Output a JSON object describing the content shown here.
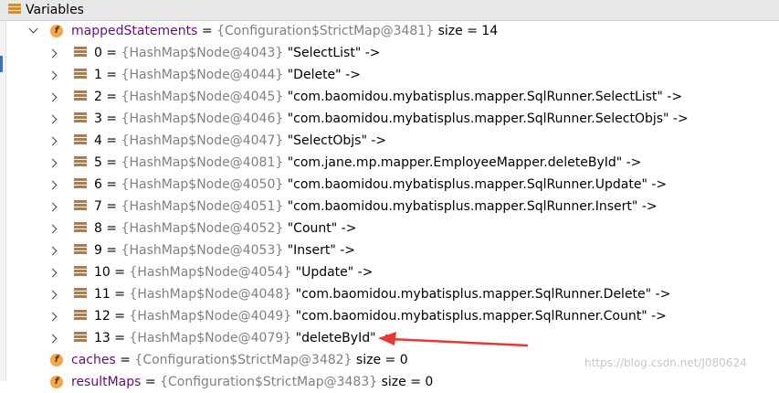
{
  "panel": {
    "title": "Variables"
  },
  "mapped": {
    "name": "mappedStatements",
    "ref": "{Configuration$StrictMap@3481}",
    "size": "size = 14",
    "entries": [
      {
        "key": "0",
        "ref": "{HashMap$Node@4043}",
        "value": "\"SelectList\" ->"
      },
      {
        "key": "1",
        "ref": "{HashMap$Node@4044}",
        "value": "\"Delete\" ->"
      },
      {
        "key": "2",
        "ref": "{HashMap$Node@4045}",
        "value": "\"com.baomidou.mybatisplus.mapper.SqlRunner.SelectList\" ->"
      },
      {
        "key": "3",
        "ref": "{HashMap$Node@4046}",
        "value": "\"com.baomidou.mybatisplus.mapper.SqlRunner.SelectObjs\" ->"
      },
      {
        "key": "4",
        "ref": "{HashMap$Node@4047}",
        "value": "\"SelectObjs\" ->"
      },
      {
        "key": "5",
        "ref": "{HashMap$Node@4081}",
        "value": "\"com.jane.mp.mapper.EmployeeMapper.deleteById\" ->"
      },
      {
        "key": "6",
        "ref": "{HashMap$Node@4050}",
        "value": "\"com.baomidou.mybatisplus.mapper.SqlRunner.Update\" ->"
      },
      {
        "key": "7",
        "ref": "{HashMap$Node@4051}",
        "value": "\"com.baomidou.mybatisplus.mapper.SqlRunner.Insert\" ->"
      },
      {
        "key": "8",
        "ref": "{HashMap$Node@4052}",
        "value": "\"Count\" ->"
      },
      {
        "key": "9",
        "ref": "{HashMap$Node@4053}",
        "value": "\"Insert\" ->"
      },
      {
        "key": "10",
        "ref": "{HashMap$Node@4054}",
        "value": "\"Update\" ->"
      },
      {
        "key": "11",
        "ref": "{HashMap$Node@4048}",
        "value": "\"com.baomidou.mybatisplus.mapper.SqlRunner.Delete\" ->"
      },
      {
        "key": "12",
        "ref": "{HashMap$Node@4049}",
        "value": "\"com.baomidou.mybatisplus.mapper.SqlRunner.Count\" ->"
      },
      {
        "key": "13",
        "ref": "{HashMap$Node@4079}",
        "value": "\"deleteById\" ->"
      }
    ]
  },
  "caches": {
    "name": "caches",
    "ref": "{Configuration$StrictMap@3482}",
    "size": "size = 0"
  },
  "resultMaps": {
    "name": "resultMaps",
    "ref": "{Configuration$StrictMap@3483}",
    "size": "size = 0"
  },
  "watermark": "https://blog.csdn.net/J080624",
  "colors": {
    "field_name": "#660e7a",
    "object_ref": "#808080",
    "annotation_arrow": "#e53935",
    "field_icon": "#f2a64b"
  },
  "icons": {
    "field": "field-icon",
    "entry": "map-entry-icon",
    "panel": "variables-icon"
  }
}
